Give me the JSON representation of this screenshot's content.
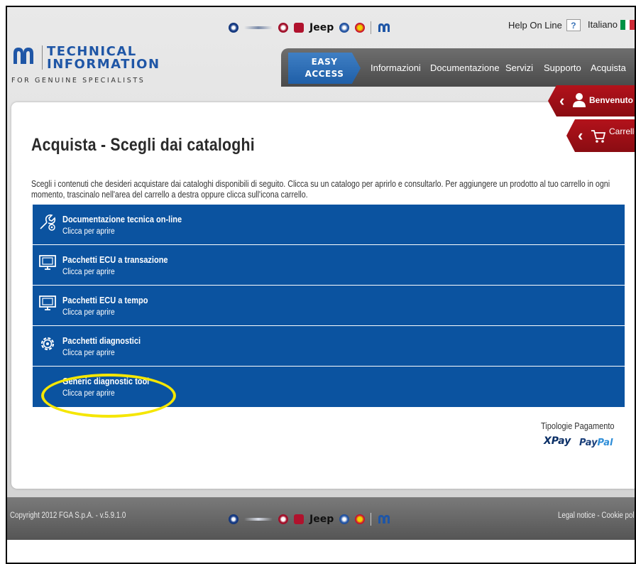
{
  "header": {
    "brands": [
      "alfa-romeo-icon",
      "chrysler-icon",
      "fiat-icon",
      "fiat-professional-icon",
      "Jeep",
      "lancia-icon",
      "abarth-icon",
      "mopar-icon"
    ],
    "jeep_label": "Jeep",
    "help_label": "Help On Line",
    "help_icon": "?",
    "language": "Italiano"
  },
  "logo": {
    "line1": "TECHNICAL",
    "line2": "INFORMATION",
    "tagline": "FOR GENUINE SPECIALISTS"
  },
  "nav": {
    "easy_line1": "EASY",
    "easy_line2": "ACCESS",
    "items": [
      "Informazioni",
      "Documentazione",
      "Servizi",
      "Supporto",
      "Acquista"
    ]
  },
  "side_tabs": {
    "welcome": "Benvenuto",
    "cart": "Carrello"
  },
  "page": {
    "title": "Acquista - Scegli dai cataloghi",
    "intro": "Scegli i contenuti che desideri acquistare dai cataloghi disponibili di seguito. Clicca su un catalogo per aprirlo e consultarlo. Per aggiungere un prodotto al tuo carrello in ogni momento, trascinalo nell'area del carrello a destra oppure clicca sull'icona carrello."
  },
  "catalogs": [
    {
      "title": "Documentazione tecnica on-line",
      "subtitle": "Clicca per aprire",
      "icon": "wrench-icon"
    },
    {
      "title": "Pacchetti ECU a transazione",
      "subtitle": "Clicca per aprire",
      "icon": "monitor-icon"
    },
    {
      "title": "Pacchetti ECU a tempo",
      "subtitle": "Clicca per aprire",
      "icon": "monitor-icon"
    },
    {
      "title": "Pacchetti diagnostici",
      "subtitle": "Clicca per aprire",
      "icon": "gear-icon"
    },
    {
      "title": "Generic diagnostic tool",
      "subtitle": "Clicca per aprire",
      "icon": ""
    }
  ],
  "payment": {
    "label": "Tipologie Pagamento",
    "xpay": "XPay",
    "paypal_a": "Pay",
    "paypal_b": "Pal"
  },
  "footer": {
    "copyright": "Copyright 2012 FGA S.p.A. - v.5.9.1.0",
    "legal": "Legal notice - Cookie policy"
  },
  "colors": {
    "catalog_blue": "#0b53a0",
    "nav_accent": "#1f5fa8",
    "tab_red": "#b3121b",
    "highlight_yellow": "#f5e600"
  }
}
